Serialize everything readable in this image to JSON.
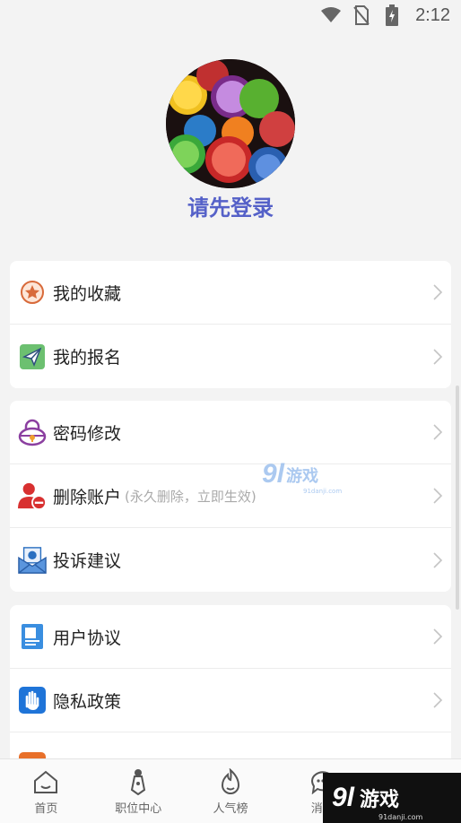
{
  "status_bar": {
    "time": "2:12",
    "icons": [
      "wifi-icon",
      "no-sim-icon",
      "battery-charging-icon"
    ]
  },
  "profile": {
    "login_prompt": "请先登录"
  },
  "menu": {
    "group1": [
      {
        "label": "我的收藏",
        "icon": "favorite-star-icon"
      },
      {
        "label": "我的报名",
        "icon": "paper-plane-icon"
      }
    ],
    "group2": [
      {
        "label": "密码修改",
        "icon": "lock-icon"
      },
      {
        "label": "删除账户",
        "hint": "(永久删除，立即生效)",
        "icon": "delete-user-icon"
      },
      {
        "label": "投诉建议",
        "icon": "feedback-mail-icon"
      }
    ],
    "group3": [
      {
        "label": "用户协议",
        "icon": "document-icon"
      },
      {
        "label": "隐私政策",
        "icon": "hand-icon"
      }
    ]
  },
  "watermark": {
    "brand_num": "9l",
    "brand_cn": "游戏",
    "url": "91danji.com"
  },
  "tabbar": {
    "tabs": [
      {
        "label": "首页",
        "icon": "home-icon"
      },
      {
        "label": "职位中心",
        "icon": "tie-icon"
      },
      {
        "label": "人气榜",
        "icon": "flame-icon"
      },
      {
        "label": "消息",
        "icon": "message-icon"
      }
    ]
  },
  "corner_badge": {
    "num": "9l",
    "cn": "游戏",
    "url": "91danji.com"
  }
}
